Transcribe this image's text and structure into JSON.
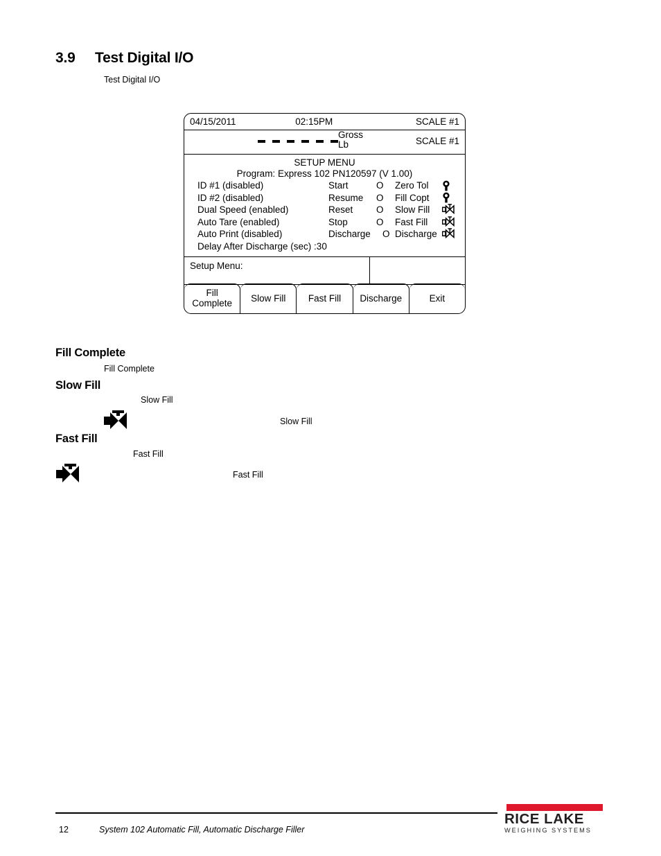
{
  "section": {
    "number": "3.9",
    "title": "Test Digital I/O",
    "sub_reference": "Test Digital I/O"
  },
  "display_panel": {
    "status_bar": {
      "date": "04/15/2011",
      "time": "02:15PM",
      "scale": "SCALE #1"
    },
    "weight": {
      "value_dashes": "- - - - - -",
      "dash_count": 6,
      "mode": "Gross",
      "unit": "Lb",
      "scale": "SCALE #1"
    },
    "setup": {
      "title": "SETUP MENU",
      "program": "Program: Express 102 PN120597 (V 1.00)",
      "rows": [
        {
          "left": "ID #1 (disabled)",
          "mid": "Start",
          "state": "O",
          "right": "Zero Tol",
          "icon": "light-bulb-icon"
        },
        {
          "left": "ID #2 (disabled)",
          "mid": "Resume",
          "state": "O",
          "right": "Fill Copt",
          "icon": "light-bulb-icon"
        },
        {
          "left": "Dual Speed (enabled)",
          "mid": "Reset",
          "state": "O",
          "right": "Slow Fill",
          "icon": "valve-outline-icon"
        },
        {
          "left": "Auto Tare (enabled)",
          "mid": "Stop",
          "state": "O",
          "right": "Fast Fill",
          "icon": "valve-outline-icon"
        },
        {
          "left": "Auto Print (disabled)",
          "mid": "Discharge",
          "state": "O",
          "right": "Discharge",
          "icon": "valve-outline-icon"
        }
      ],
      "delay": "Delay After Discharge (sec) :30"
    },
    "prompt": {
      "label": "Setup Menu:",
      "value": ""
    },
    "softkeys": [
      {
        "label": "Fill\nComplete"
      },
      {
        "label": "Slow Fill"
      },
      {
        "label": "Fast Fill"
      },
      {
        "label": "Discharge"
      },
      {
        "label": "Exit"
      }
    ]
  },
  "sections": [
    {
      "heading": "Fill Complete",
      "ref_inline": "Fill Complete"
    },
    {
      "heading": "Slow Fill",
      "ref_inline": "Slow Fill",
      "ref_trailing": "Slow Fill",
      "icon": "valve-solid-icon"
    },
    {
      "heading": "Fast Fill",
      "ref_inline": "Fast Fill",
      "ref_trailing": "Fast Fill",
      "icon": "valve-solid-icon"
    }
  ],
  "footer": {
    "page_number": "12",
    "document_title": "System 102 Automatic Fill, Automatic Discharge Filler",
    "logo": {
      "name": "RICE LAKE",
      "tagline": "WEIGHING SYSTEMS",
      "bar_color": "#e0182d",
      "text_color": "#231f20"
    }
  }
}
